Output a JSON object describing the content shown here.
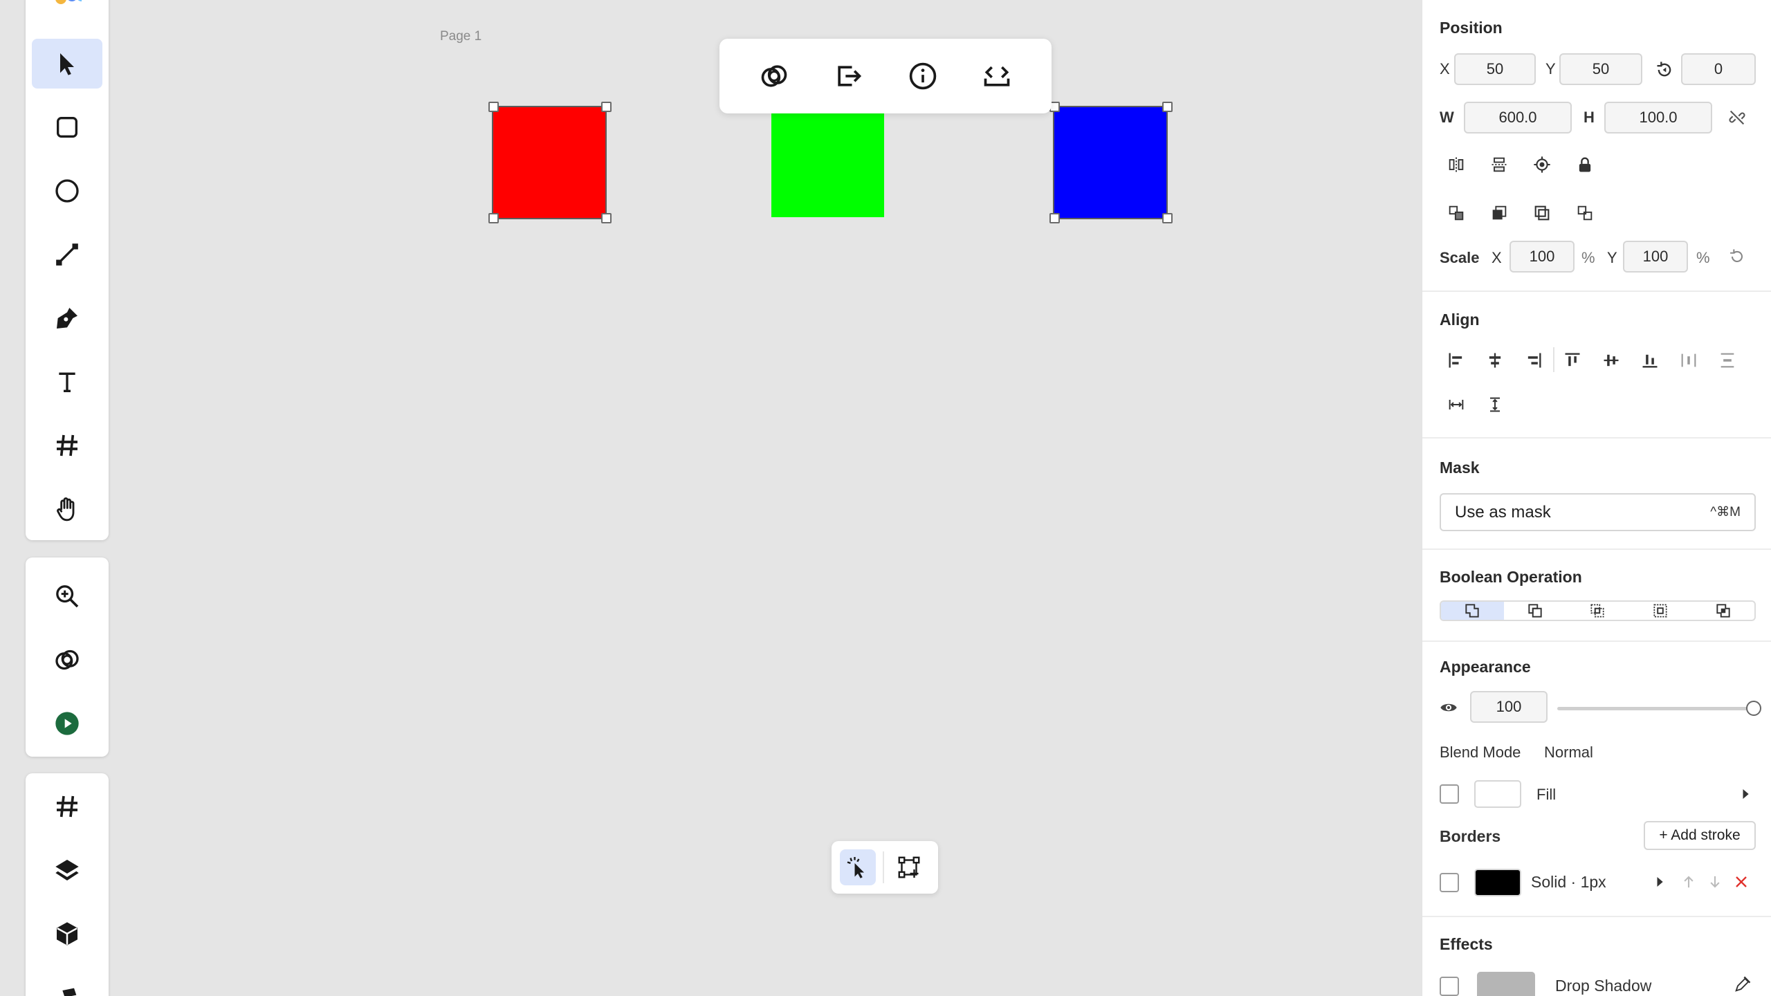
{
  "canvas": {
    "page_label": "Page 1",
    "shapes": [
      {
        "name": "red-rectangle",
        "color": "#ff0000",
        "selected": true
      },
      {
        "name": "green-rectangle",
        "color": "#00ff00",
        "selected": false
      },
      {
        "name": "blue-rectangle",
        "color": "#0000ff",
        "selected": true
      }
    ]
  },
  "toolbar": {
    "tools": [
      "select-tool",
      "rectangle-tool",
      "ellipse-tool",
      "line-tool",
      "pen-tool",
      "text-tool",
      "frame-tool",
      "hand-tool"
    ],
    "secondary": [
      "zoom-tool",
      "boolean-tool",
      "play-button"
    ],
    "panels": [
      "frames-panel",
      "layers-panel",
      "assets-panel"
    ],
    "accent_color": "#dbe5fb"
  },
  "context_bar": {
    "icons": [
      "boolean-icon",
      "export-icon",
      "info-icon",
      "code-icon"
    ]
  },
  "bottom_bar": {
    "icons": [
      "smart-select-icon",
      "transform-icon"
    ]
  },
  "panel": {
    "position": {
      "title": "Position",
      "x_label": "X",
      "x_value": "50",
      "y_label": "Y",
      "y_value": "50",
      "rotation_value": "0",
      "w_label": "W",
      "w_value": "600.0",
      "h_label": "H",
      "h_value": "100.0",
      "scale_label": "Scale",
      "scale_x_label": "X",
      "scale_x_value": "100",
      "scale_y_label": "Y",
      "scale_y_value": "100",
      "percent": "%"
    },
    "align": {
      "title": "Align"
    },
    "mask": {
      "title": "Mask",
      "button_label": "Use as mask",
      "shortcut": "^⌘M"
    },
    "boolean": {
      "title": "Boolean Operation"
    },
    "appearance": {
      "title": "Appearance",
      "opacity_value": "100",
      "opacity_level": 1.0,
      "blend_label": "Blend Mode",
      "blend_value": "Normal",
      "fill_label": "Fill",
      "fill_color": "#ffffff"
    },
    "borders": {
      "title": "Borders",
      "add_label": "+ Add stroke",
      "stroke_label": "Solid · 1px",
      "stroke_color": "#000000"
    },
    "effects": {
      "title": "Effects",
      "effect_label": "Drop Shadow",
      "effect_color": "#b5b5b5"
    }
  }
}
